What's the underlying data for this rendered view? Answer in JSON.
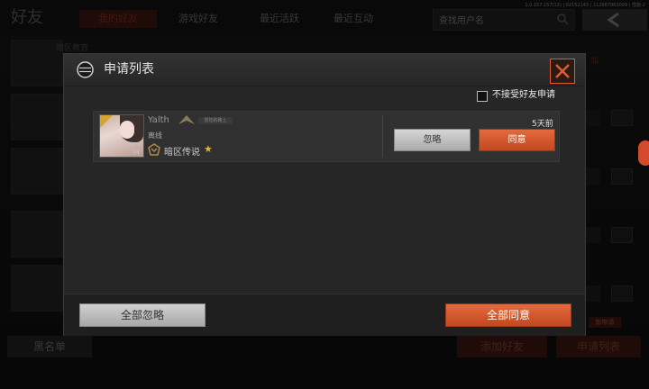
{
  "version": "1.0.157.157(12) | 02152143 | 112667963009 | 性能-2",
  "topbar": {
    "title": "好友",
    "tabs": [
      {
        "label": "我的好友",
        "active": true
      },
      {
        "label": "游戏好友",
        "active": false
      },
      {
        "label": "最近活跃",
        "active": false
      },
      {
        "label": "最近互动",
        "active": false
      }
    ],
    "search_placeholder": "查找用户名"
  },
  "background": {
    "player_name": "暗区教官",
    "side_button": "加",
    "blacklist_label": "黑名单",
    "add_friend_label": "添加好友",
    "request_list_label": "申请列表",
    "new_request_badge": "新申请"
  },
  "modal": {
    "title": "申请列表",
    "reject_all_option": "不接受好友申请",
    "requests": [
      {
        "name": "Yalth",
        "tag": "冒险的路上",
        "status": "离线",
        "level": "58",
        "rank": "暗区传说",
        "time": "5天前",
        "ignore_label": "忽略",
        "accept_label": "同意"
      }
    ],
    "ignore_all_label": "全部忽略",
    "accept_all_label": "全部同意"
  },
  "colors": {
    "accent": "#d4552c",
    "close_border": "#e05b35"
  }
}
